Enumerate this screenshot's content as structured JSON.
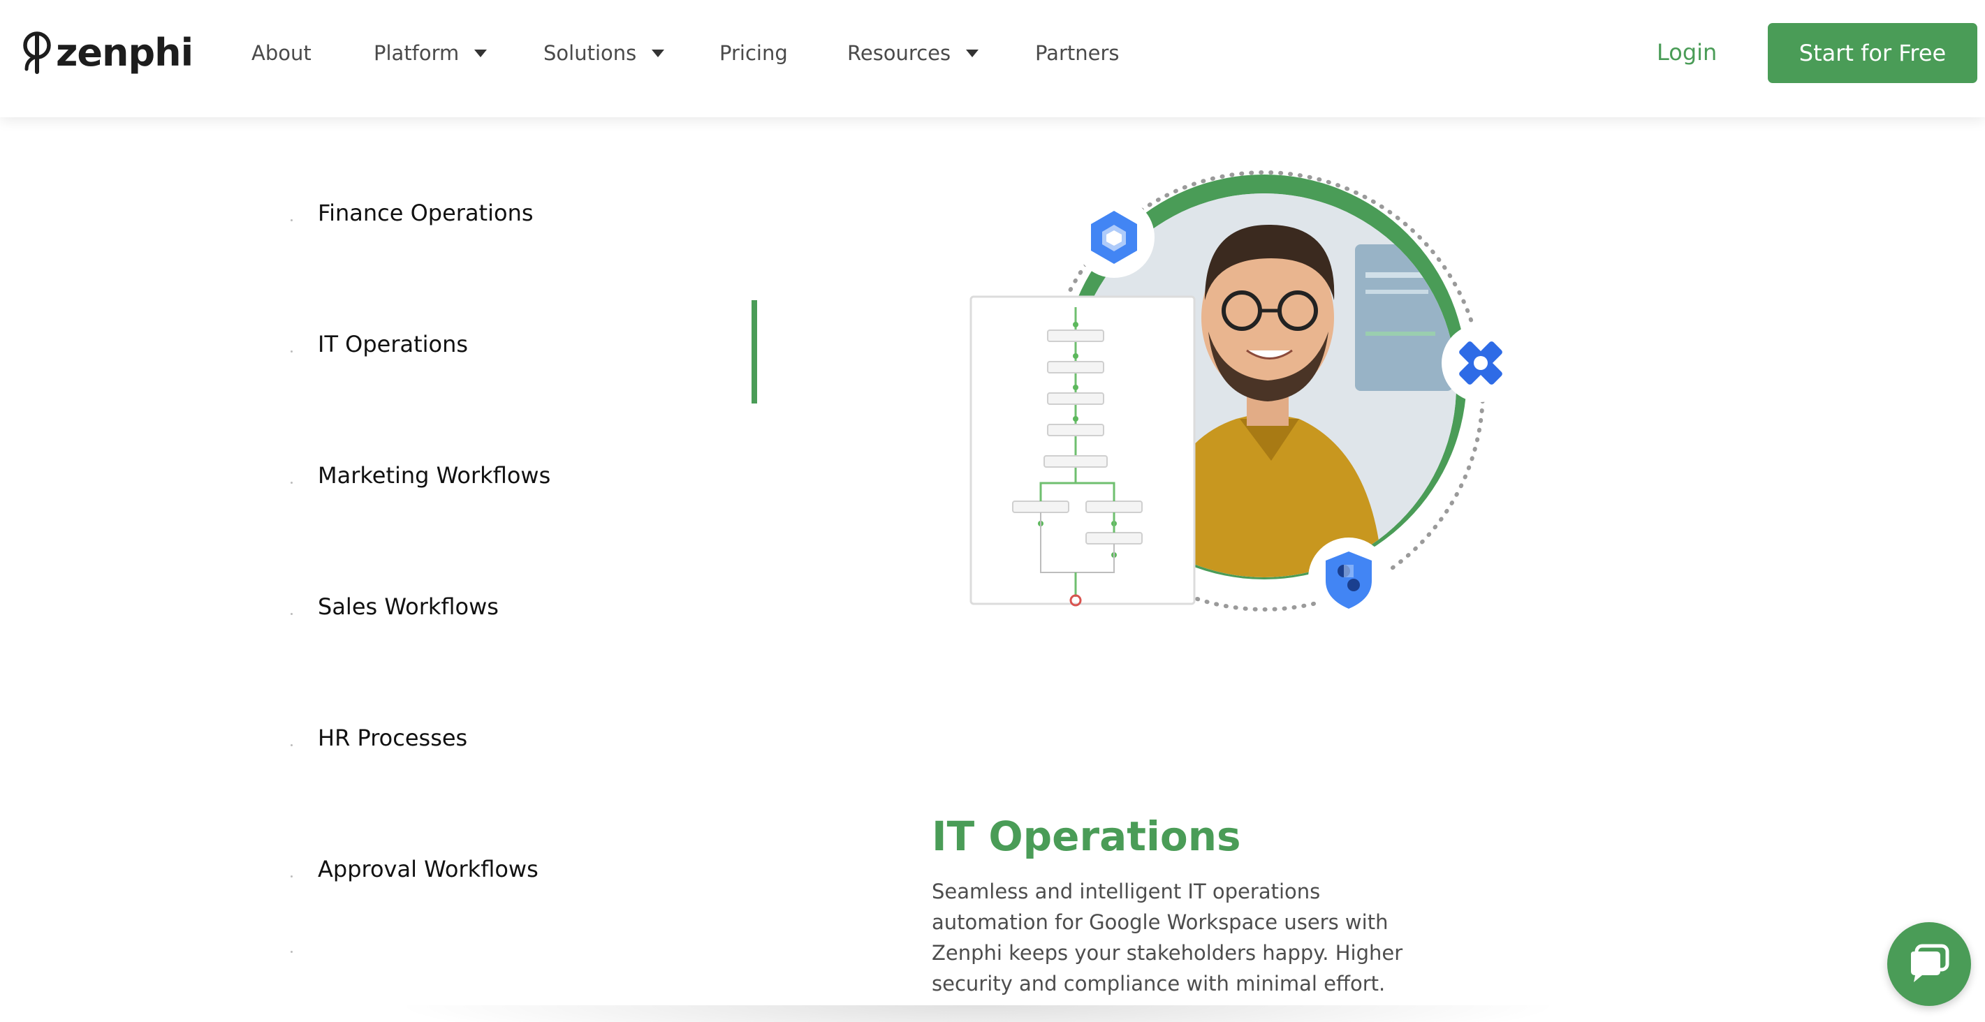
{
  "brand": {
    "logo_text": "zenphi",
    "accent_color": "#4a9c57"
  },
  "nav": {
    "items": [
      {
        "label": "About",
        "dropdown": false
      },
      {
        "label": "Platform",
        "dropdown": true
      },
      {
        "label": "Solutions",
        "dropdown": true
      },
      {
        "label": "Pricing",
        "dropdown": false
      },
      {
        "label": "Resources",
        "dropdown": true
      },
      {
        "label": "Partners",
        "dropdown": false
      }
    ],
    "login_label": "Login",
    "cta_label": "Start for Free"
  },
  "tabs": {
    "items": [
      {
        "label": "Finance Operations",
        "active": false
      },
      {
        "label": "IT Operations",
        "active": true
      },
      {
        "label": "Marketing Workflows",
        "active": false
      },
      {
        "label": "Sales Workflows",
        "active": false
      },
      {
        "label": "HR Processes",
        "active": false
      },
      {
        "label": "Approval Workflows",
        "active": false
      }
    ]
  },
  "content": {
    "title": "IT Operations",
    "description": "Seamless and intelligent IT operations automation for Google Workspace users with Zenphi keeps your stakeholders happy. Higher security and compliance with minimal effort."
  },
  "illustration": {
    "icons": [
      "google-cloud-icon",
      "jira-icon",
      "security-shield-icon"
    ]
  },
  "chat": {
    "icon": "chat-icon"
  }
}
